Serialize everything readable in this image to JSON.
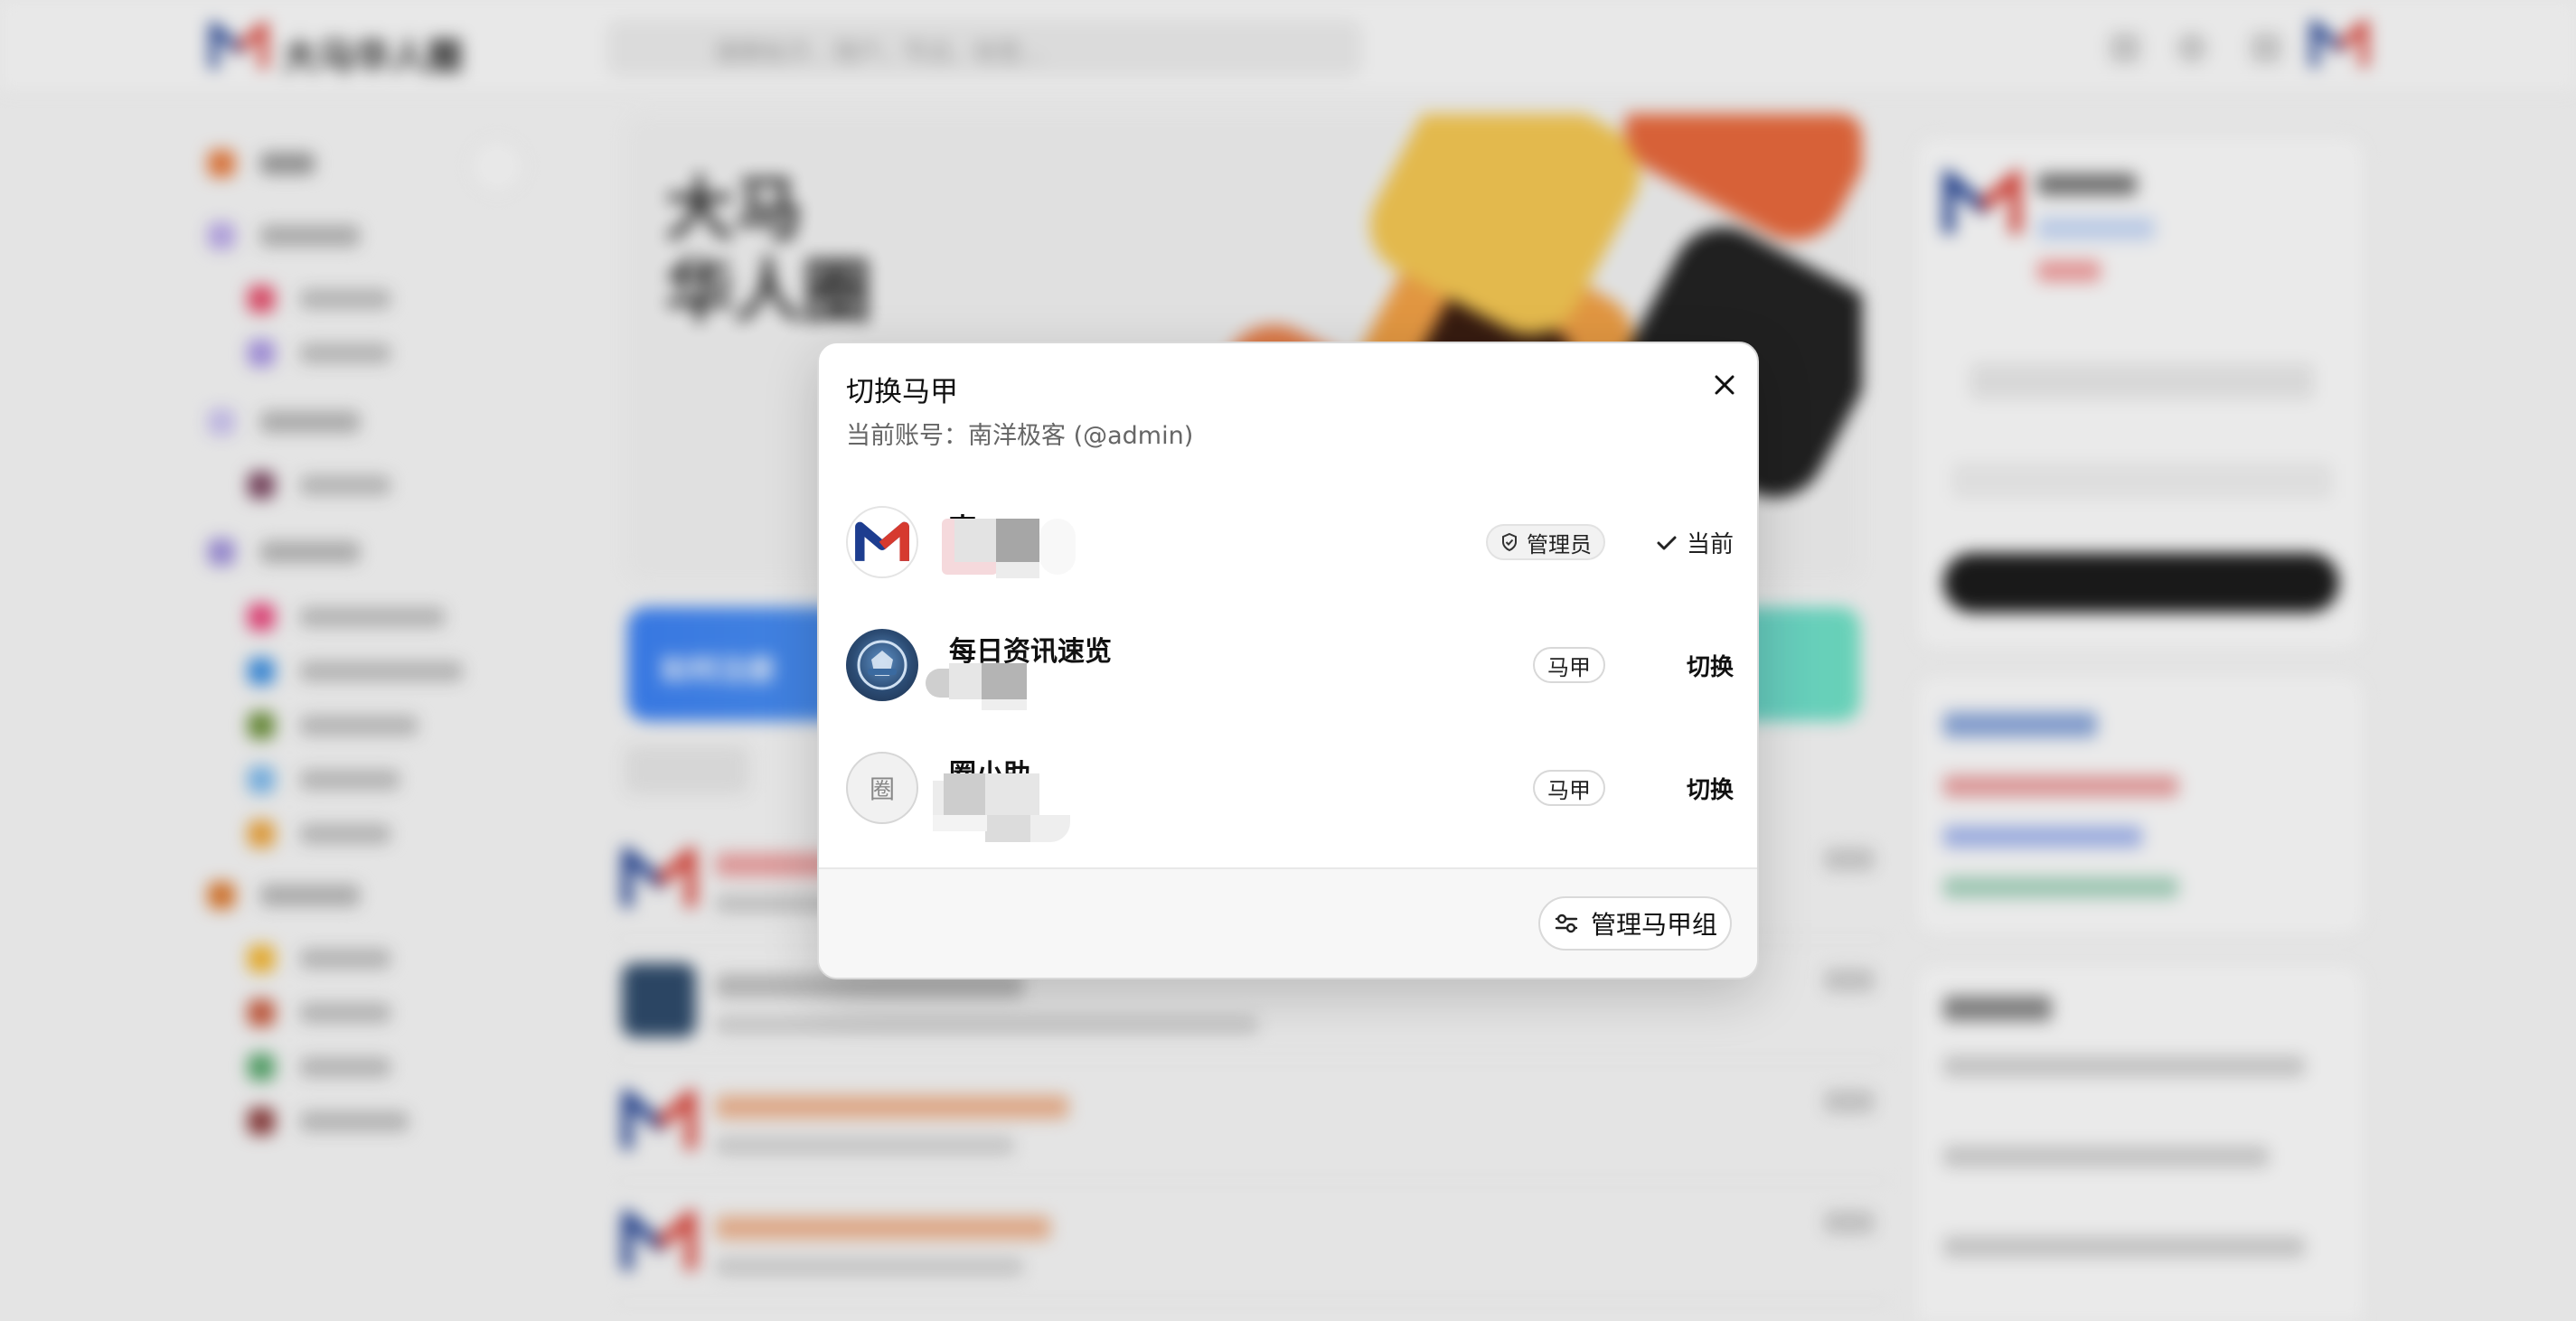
{
  "background": {
    "brand": "大马华人圈",
    "search_placeholder": "搜索帖子、用户、节点、标签...",
    "hero_title_line1": "大马",
    "hero_title_line2": "华人圈",
    "banner_text": "如何注册"
  },
  "modal": {
    "title": "切换马甲",
    "subtitle": "当前账号：南洋极客 (@admin)",
    "accounts": [
      {
        "name": "南",
        "badge": "管理员",
        "badge_icon": "shield-icon",
        "action": "当前",
        "action_icon": "check-icon",
        "avatar_icon": "brand-m-logo"
      },
      {
        "name": "每日资讯速览",
        "badge": "马甲",
        "action": "切换",
        "avatar_icon": "team-emblem-avatar"
      },
      {
        "name": "圈小助",
        "badge": "马甲",
        "action": "切换",
        "avatar_glyph": "圈"
      }
    ],
    "manage_label": "管理马甲组",
    "manage_icon": "sliders-icon"
  },
  "colors": {
    "brand_blue": "#1d3d8f",
    "brand_red": "#d63a2f",
    "banner_blue": "#3b7ff0",
    "banner_teal": "#6fe0c3"
  }
}
